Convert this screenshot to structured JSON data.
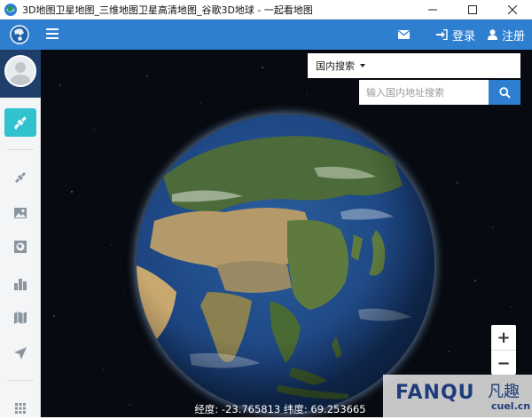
{
  "window": {
    "title": "3D地图卫星地图_三维地图卫星高清地图_谷歌3D地球 - 一起看地图",
    "controls": [
      "minimize-icon",
      "maximize-icon",
      "close-icon"
    ]
  },
  "colors": {
    "brand": "#2f7fd1",
    "active": "#31c2d0",
    "space": "#070a10"
  },
  "nav": {
    "logo": "globe-logo-icon",
    "menu_icon": "hamburger-menu-icon",
    "mail_icon": "mail-icon",
    "login_label": "登录",
    "register_label": "注册"
  },
  "sidebar": {
    "avatar": "avatar",
    "items": [
      {
        "icon": "satellite-icon",
        "active": true
      },
      {
        "icon": "satellite-icon",
        "active": false
      },
      {
        "icon": "photo-map-icon",
        "active": false
      },
      {
        "icon": "globe-square-icon",
        "active": false
      },
      {
        "icon": "buildings-icon",
        "active": false
      },
      {
        "icon": "map-icon",
        "active": false
      },
      {
        "icon": "navigation-arrow-icon",
        "active": false
      },
      {
        "icon": "grid-apps-icon",
        "active": false
      }
    ]
  },
  "search": {
    "type_label": "国内搜索",
    "placeholder": "输入国内地址搜索",
    "button_icon": "search-icon"
  },
  "zoom": {
    "in_label": "+",
    "out_label": "−"
  },
  "coordinates": {
    "text": "经度: -23.765813 纬度: 69.253665"
  },
  "watermark": {
    "main": "FANQU",
    "cn": "凡趣",
    "sub": "cuel.cn"
  }
}
